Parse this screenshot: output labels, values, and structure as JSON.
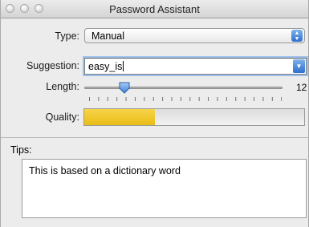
{
  "window": {
    "title": "Password Assistant"
  },
  "type": {
    "label": "Type:",
    "selected": "Manual"
  },
  "suggestion": {
    "label": "Suggestion:",
    "value": "easy_is"
  },
  "length": {
    "label": "Length:",
    "max": "12",
    "value_fraction": 0.18
  },
  "quality": {
    "label": "Quality:",
    "level_fraction": 0.32,
    "fill_color": "#e9bd16"
  },
  "tips": {
    "label": "Tips:",
    "text": "This is based on a dictionary word"
  },
  "icons": {
    "close": "close-icon",
    "minimize": "minimize-icon",
    "zoom": "zoom-icon",
    "popup_arrows": "updown-arrows-icon",
    "combo_arrow": "chevron-down-icon"
  }
}
